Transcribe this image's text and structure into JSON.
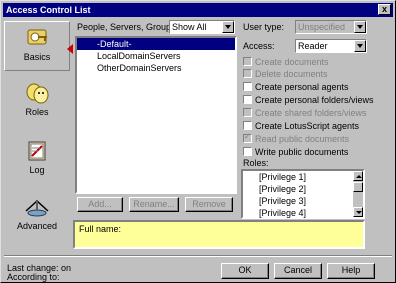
{
  "window": {
    "title": "Access Control List",
    "close": "x"
  },
  "nav": [
    {
      "label": "Basics",
      "icon": "key-icon",
      "selected": true
    },
    {
      "label": "Roles",
      "icon": "masks-icon",
      "selected": false
    },
    {
      "label": "Log",
      "icon": "logbook-icon",
      "selected": false
    },
    {
      "label": "Advanced",
      "icon": "advanced-icon",
      "selected": false
    }
  ],
  "people": {
    "label": "People, Servers, Groups:",
    "filter": "Show All",
    "items": [
      "-Default-",
      "LocalDomainServers",
      "OtherDomainServers"
    ],
    "selected_index": 0,
    "add": "Add...",
    "rename": "Rename...",
    "remove": "Remove"
  },
  "user_type": {
    "label": "User type:",
    "value": "Unspecified"
  },
  "access": {
    "label": "Access:",
    "value": "Reader"
  },
  "permissions": [
    {
      "label": "Create documents",
      "checked": false,
      "disabled": true
    },
    {
      "label": "Delete documents",
      "checked": false,
      "disabled": true
    },
    {
      "label": "Create personal agents",
      "checked": false,
      "disabled": false
    },
    {
      "label": "Create personal folders/views",
      "checked": false,
      "disabled": false
    },
    {
      "label": "Create shared folders/views",
      "checked": false,
      "disabled": true
    },
    {
      "label": "Create LotusScript agents",
      "checked": false,
      "disabled": false
    },
    {
      "label": "Read public documents",
      "checked": true,
      "disabled": true
    },
    {
      "label": "Write public documents",
      "checked": false,
      "disabled": false
    }
  ],
  "roles": {
    "label": "Roles:",
    "items": [
      "[Privilege 1]",
      "[Privilege 2]",
      "[Privilege 3]",
      "[Privilege 4]"
    ]
  },
  "full_name": {
    "label": "Full name:"
  },
  "footer": {
    "last_change": "Last change:  on",
    "according_to": "According to:"
  },
  "buttons": {
    "ok": "OK",
    "cancel": "Cancel",
    "help": "Help"
  }
}
